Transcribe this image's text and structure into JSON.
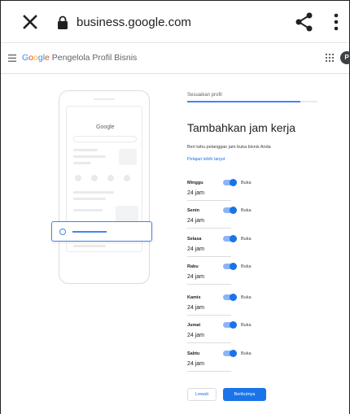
{
  "browser": {
    "url": "business.google.com",
    "icons": [
      "close-icon",
      "lock-icon",
      "share-icon",
      "more-vert-icon"
    ]
  },
  "appbar": {
    "brand_letters": [
      "G",
      "o",
      "o",
      "g",
      "l",
      "e"
    ],
    "product": " Pengelola Profil Bisnis",
    "avatar_letter": "P",
    "icons": [
      "hamburger-icon",
      "apps-icon"
    ]
  },
  "illustration": {
    "logo": "Google"
  },
  "form": {
    "step_label": "Sesuaikan profil",
    "progress": 0.87,
    "title": "Tambahkan jam kerja",
    "description": "Beri tahu pelanggan jam buka bisnis Anda",
    "learn_more": "Pelajari lebih lanjut",
    "days": [
      {
        "name": "Minggu",
        "state": "Buka",
        "hours": "24 jam"
      },
      {
        "name": "Senin",
        "state": "Buka",
        "hours": "24 jam"
      },
      {
        "name": "Selasa",
        "state": "Buka",
        "hours": "24 jam"
      },
      {
        "name": "Rabu",
        "state": "Buka",
        "hours": "24 jam"
      },
      {
        "name": "Kamis",
        "state": "Buka",
        "hours": "24 jam"
      },
      {
        "name": "Jumat",
        "state": "Buka",
        "hours": "24 jam"
      },
      {
        "name": "Sabtu",
        "state": "Buka",
        "hours": "24 jam"
      }
    ],
    "skip_label": "Lewati",
    "next_label": "Berikutnya"
  },
  "colors": {
    "accent": "#1a73e8",
    "toggle_track": "#8ab4f8"
  }
}
